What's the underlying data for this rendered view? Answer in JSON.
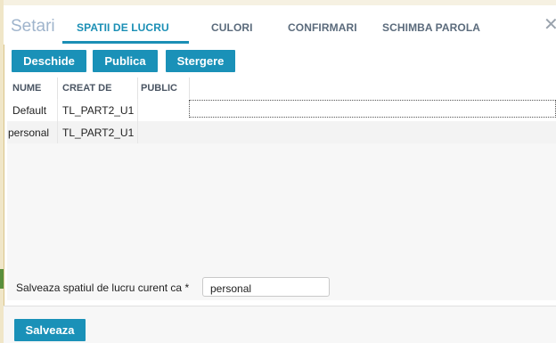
{
  "dialog": {
    "title": "Setari",
    "close_glyph": "✕",
    "tabs": [
      {
        "label": "SPATII DE LUCRU",
        "active": true
      },
      {
        "label": "CULORI",
        "active": false
      },
      {
        "label": "CONFIRMARI",
        "active": false
      },
      {
        "label": "SCHIMBA PAROLA",
        "active": false
      }
    ]
  },
  "toolbar": {
    "open_label": "Deschide",
    "publish_label": "Publica",
    "delete_label": "Stergere"
  },
  "table": {
    "columns": [
      "NUME",
      "CREAT DE",
      "PUBLIC"
    ],
    "rows": [
      {
        "name": "Default",
        "created_by": "TL_PART2_U1",
        "public": ""
      },
      {
        "name": "personal",
        "created_by": "TL_PART2_U1",
        "public": ""
      }
    ]
  },
  "save_form": {
    "label": "Salveaza spatiul de lucru curent ca *",
    "value": "personal",
    "save_label": "Salveaza"
  },
  "colors": {
    "accent": "#1a91b8",
    "title": "#9fb4cc"
  }
}
